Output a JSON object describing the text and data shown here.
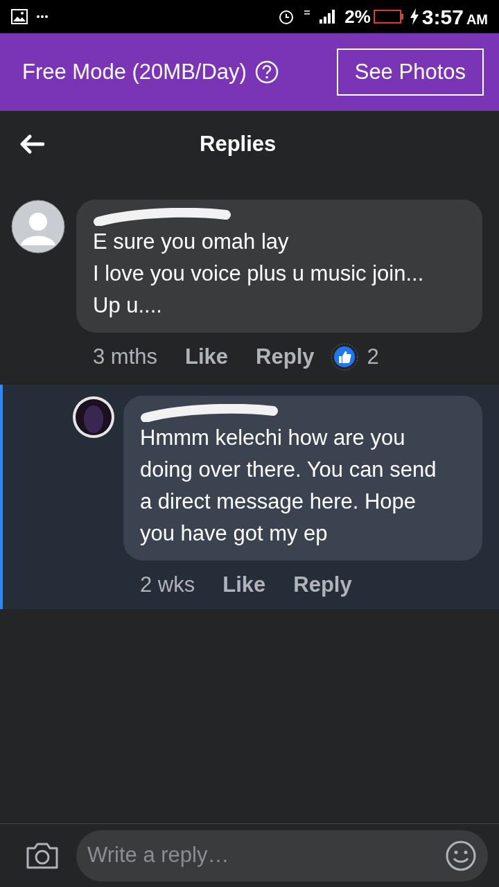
{
  "status_bar": {
    "battery": "2%",
    "time": "3:57",
    "ampm": "AM"
  },
  "banner": {
    "text": "Free Mode (20MB/Day)",
    "button": "See Photos"
  },
  "header": {
    "title": "Replies"
  },
  "comments": [
    {
      "kind": "comment",
      "highlighted": false,
      "lines": [
        "E sure you omah lay",
        "I love you voice plus u music join...",
        "Up u...."
      ],
      "time": "3 mths",
      "like": "Like",
      "reply": "Reply",
      "reactions": "2"
    },
    {
      "kind": "reply",
      "highlighted": true,
      "lines": [
        "Hmmm kelechi how are you",
        "doing over there. You can send",
        "a direct message here. Hope",
        "you have got my ep"
      ],
      "time": "2 wks",
      "like": "Like",
      "reply": "Reply"
    }
  ],
  "composer": {
    "placeholder": "Write a reply…"
  }
}
